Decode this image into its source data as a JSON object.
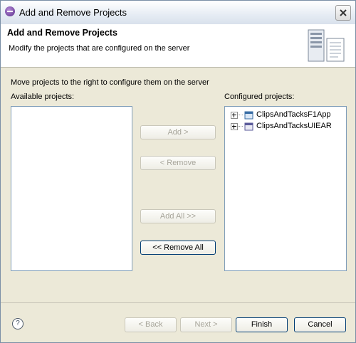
{
  "window": {
    "title": "Add and Remove Projects"
  },
  "header": {
    "title": "Add and Remove Projects",
    "description": "Modify the projects that are configured on the server"
  },
  "instruction": "Move projects to the right to configure them on the server",
  "available": {
    "label": "Available projects:",
    "items": []
  },
  "configured": {
    "label": "Configured projects:",
    "items": [
      {
        "label": "ClipsAndTacksF1App",
        "icon": "web-project-icon"
      },
      {
        "label": "ClipsAndTacksUIEAR",
        "icon": "ear-project-icon"
      }
    ]
  },
  "buttons": {
    "add": "Add >",
    "remove": "< Remove",
    "add_all": "Add All >>",
    "remove_all": "<< Remove All"
  },
  "footer": {
    "back": "< Back",
    "next": "Next >",
    "finish": "Finish",
    "cancel": "Cancel"
  },
  "icons": {
    "app": "eclipse-icon",
    "close": "close-icon",
    "help": "help-icon",
    "header": "server-wizard-icon"
  }
}
